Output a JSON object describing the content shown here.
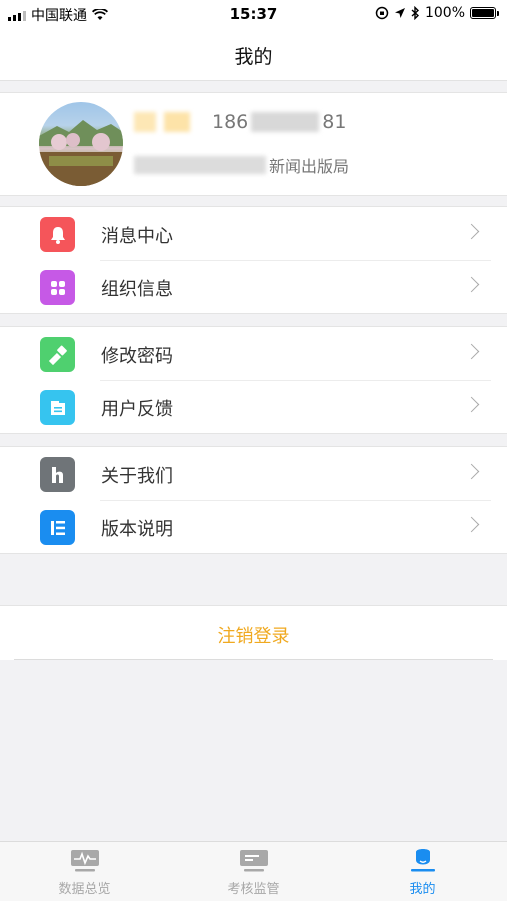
{
  "status_bar": {
    "carrier": "中国联通",
    "time": "15:37",
    "battery": "100%"
  },
  "header": {
    "title": "我的"
  },
  "profile": {
    "phone_prefix": "186",
    "phone_suffix": "81",
    "org_suffix": "新闻出版局"
  },
  "groups": [
    {
      "items": [
        {
          "label": "消息中心",
          "icon": "bell-icon",
          "color": "#f5555a"
        },
        {
          "label": "组织信息",
          "icon": "grid-icon",
          "color": "#c659e6"
        }
      ]
    },
    {
      "items": [
        {
          "label": "修改密码",
          "icon": "key-icon",
          "color": "#4fd06f"
        },
        {
          "label": "用户反馈",
          "icon": "feedback-icon",
          "color": "#36c4ef"
        }
      ]
    },
    {
      "items": [
        {
          "label": "关于我们",
          "icon": "about-h-icon",
          "color": "#6f7478"
        },
        {
          "label": "版本说明",
          "icon": "version-list-icon",
          "color": "#1a8df0"
        }
      ]
    }
  ],
  "logout": {
    "label": "注销登录",
    "color": "#f0a920"
  },
  "tabbar": {
    "tabs": [
      {
        "label": "数据总览",
        "icon": "pulse-chart-icon",
        "active": false
      },
      {
        "label": "考核监管",
        "icon": "card-icon",
        "active": false
      },
      {
        "label": "我的",
        "icon": "person-icon",
        "active": true
      }
    ],
    "active_color": "#1a8df0",
    "inactive_color": "#a8a8a8"
  }
}
